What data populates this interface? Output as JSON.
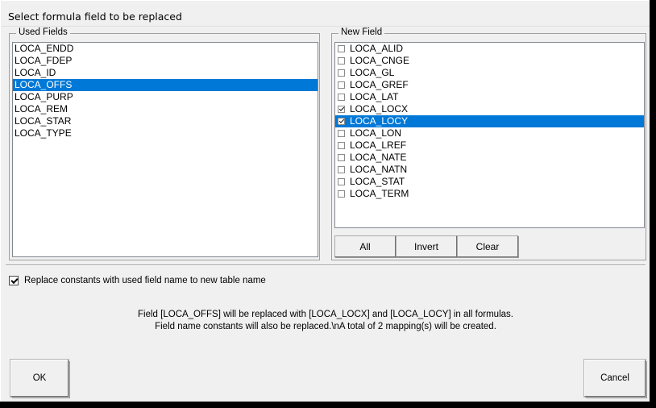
{
  "window": {
    "title": "Select formula field to be replaced"
  },
  "used_fields": {
    "group_label": "Used Fields",
    "items": [
      {
        "label": "LOCA_ENDD",
        "selected": false
      },
      {
        "label": "LOCA_FDEP",
        "selected": false
      },
      {
        "label": "LOCA_ID",
        "selected": false
      },
      {
        "label": "LOCA_OFFS",
        "selected": true
      },
      {
        "label": "LOCA_PURP",
        "selected": false
      },
      {
        "label": "LOCA_REM",
        "selected": false
      },
      {
        "label": "LOCA_STAR",
        "selected": false
      },
      {
        "label": "LOCA_TYPE",
        "selected": false
      }
    ]
  },
  "new_field": {
    "group_label": "New Field",
    "items": [
      {
        "label": "LOCA_ALID",
        "checked": false,
        "selected": false
      },
      {
        "label": "LOCA_CNGE",
        "checked": false,
        "selected": false
      },
      {
        "label": "LOCA_GL",
        "checked": false,
        "selected": false
      },
      {
        "label": "LOCA_GREF",
        "checked": false,
        "selected": false
      },
      {
        "label": "LOCA_LAT",
        "checked": false,
        "selected": false
      },
      {
        "label": "LOCA_LOCX",
        "checked": true,
        "selected": false
      },
      {
        "label": "LOCA_LOCY",
        "checked": true,
        "selected": true
      },
      {
        "label": "LOCA_LON",
        "checked": false,
        "selected": false
      },
      {
        "label": "LOCA_LREF",
        "checked": false,
        "selected": false
      },
      {
        "label": "LOCA_NATE",
        "checked": false,
        "selected": false
      },
      {
        "label": "LOCA_NATN",
        "checked": false,
        "selected": false
      },
      {
        "label": "LOCA_STAT",
        "checked": false,
        "selected": false
      },
      {
        "label": "LOCA_TERM",
        "checked": false,
        "selected": false
      }
    ],
    "buttons": {
      "all": "All",
      "invert": "Invert",
      "clear": "Clear"
    }
  },
  "options": {
    "replace_constants_label": "Replace constants with used field name to new table name",
    "replace_constants_checked": true
  },
  "message": {
    "line1": "Field [LOCA_OFFS] will be replaced with [LOCA_LOCX] and [LOCA_LOCY] in all formulas.",
    "line2": "Field name constants will also be replaced.\\nA total of 2 mapping(s) will be created."
  },
  "footer": {
    "ok": "OK",
    "cancel": "Cancel"
  },
  "colors": {
    "selection": "#0078d7",
    "dialog_face": "#f0f0f0",
    "list_background": "#ffffff",
    "border": "#a0a0a0"
  }
}
